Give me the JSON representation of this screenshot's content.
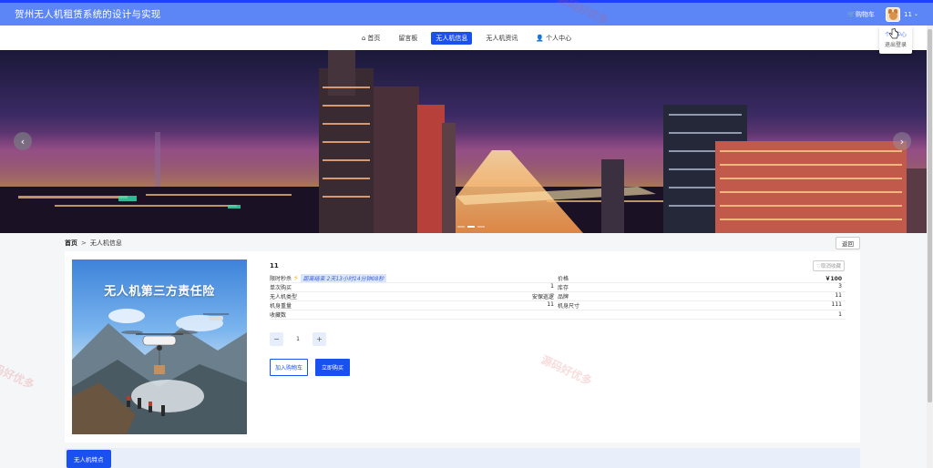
{
  "header": {
    "title": "贺州无人机租赁系统的设计与实现",
    "cart_label": "购物车",
    "username": "11"
  },
  "user_menu": {
    "items": [
      "个人中心",
      "退出登录"
    ]
  },
  "nav": {
    "items": [
      {
        "label": "首页",
        "icon": "home-icon",
        "active": false
      },
      {
        "label": "留言板",
        "active": false
      },
      {
        "label": "无人机信息",
        "active": true
      },
      {
        "label": "无人机资讯",
        "active": false
      },
      {
        "label": "个人中心",
        "icon": "user-icon",
        "active": false
      }
    ]
  },
  "banner": {
    "slide_count": 3,
    "active_slide": 1
  },
  "breadcrumb": {
    "home": "首页",
    "separator": ">",
    "current": "无人机信息",
    "back_label": "返回"
  },
  "product": {
    "name": "11",
    "fav_label": "取消收藏",
    "image_title": "无人机第三方责任险",
    "flash_sale": {
      "label": "限时秒杀",
      "countdown": "距离结束 2天13小时14分钟08秒"
    },
    "attributes": [
      {
        "left_key": "限时秒杀",
        "left_value": "",
        "right_key": "价格",
        "right_value": "￥100"
      },
      {
        "left_key": "单次购买",
        "left_value": "1",
        "right_key": "库存",
        "right_value": "3"
      },
      {
        "left_key": "无人机类型",
        "left_value": "安保巡逻",
        "right_key": "品牌",
        "right_value": "11"
      },
      {
        "left_key": "机身重量",
        "left_value": "11",
        "right_key": "机身尺寸",
        "right_value": "111"
      },
      {
        "left_key": "收藏数",
        "left_value": "",
        "right_key": "",
        "right_value": "1"
      }
    ],
    "quantity": "1",
    "minus_label": "−",
    "plus_label": "+",
    "add_cart_label": "加入购物车",
    "buy_label": "立即购买"
  },
  "features": {
    "tab_label": "无人机特点"
  },
  "watermark": {
    "text": "源码好优多"
  },
  "colors": {
    "primary": "#1a4ff0",
    "header": "#5c86f5",
    "price": "#d9221c"
  }
}
